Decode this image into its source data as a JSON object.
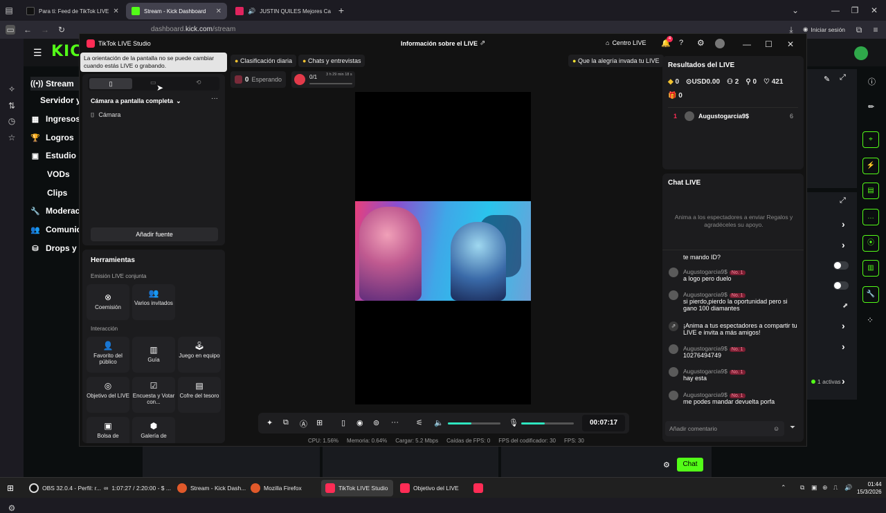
{
  "browser": {
    "tabs": [
      {
        "title": "Para ti: Feed de TikTok LIVE",
        "active": false
      },
      {
        "title": "Stream - Kick Dashboard",
        "active": true
      },
      {
        "title": "JUSTIN QUILES Mejores Ca",
        "active": false
      }
    ],
    "url_prefix": "dashboard.",
    "url_domain": "kick.com",
    "url_path": "/stream",
    "signin_label": "Iniciar sesión"
  },
  "kick": {
    "logo": "KICK",
    "menu": [
      {
        "label": "Stream",
        "icon": "stream-icon"
      },
      {
        "label": "Servidor y",
        "icon": ""
      },
      {
        "label": "Ingresos",
        "icon": "wallet-icon"
      },
      {
        "label": "Logros",
        "icon": "trophy-icon"
      },
      {
        "label": "Estudio",
        "icon": "studio-icon"
      },
      {
        "label": "VODs",
        "icon": ""
      },
      {
        "label": "Clips",
        "icon": ""
      },
      {
        "label": "Moderac",
        "icon": "moderation-icon"
      },
      {
        "label": "Comunid",
        "icon": "community-icon"
      },
      {
        "label": "Drops y r",
        "icon": "drops-icon"
      }
    ],
    "active_count": "1 activas",
    "chat_button": "Chat"
  },
  "tiktok": {
    "app_title": "TikTok LIVE Studio",
    "center_title": "Información sobre el LIVE",
    "centro_live": "Centro LIVE",
    "notif_count": "4",
    "tooltip": "La orientación de la pantalla no se puede cambiar cuando estás LIVE o grabando.",
    "scene_name": "Cámara a pantalla completa",
    "source_name": "Cámara",
    "add_source": "Añadir fuente",
    "tools_title": "Herramientas",
    "section_coop": "Emisión LIVE conjunta",
    "section_interaction": "Interacción",
    "tools_coop": [
      "Coemisión",
      "Varios invitados"
    ],
    "tools_interaction": [
      "Favorito del público",
      "Guía",
      "Juego en equipo",
      "Objetivo del LIVE",
      "Encuesta y Votar con...",
      "Cofre del tesoro",
      "Bolsa de",
      "Galería de"
    ],
    "chips": [
      "Clasificación diaria",
      "Chats y entrevistas"
    ],
    "joy_chip": "Que la alegría invada tu LIVE",
    "waiting": {
      "count": "0",
      "label": "Esperando"
    },
    "goal": {
      "progress": "0/1",
      "time": "3 h 29 min 18 s",
      "fraction": 0.0
    },
    "timer": "00:07:17",
    "volume_level": 0.45,
    "mic_level": 0.45,
    "stats": {
      "cpu": "CPU:  1.56%",
      "memory": "Memoria:  0.64%",
      "load": "Cargar:  5.2 Mbps",
      "dropped": "Caídas de FPS:  0",
      "encoder": "FPS del codificador:  30",
      "fps": "FPS:  30"
    },
    "results": {
      "title": "Resultados del LIVE",
      "diamonds": "0",
      "usd": "USD0.00",
      "viewers": "2",
      "new_followers": "0",
      "likes": "421",
      "gifts": "0",
      "rank": "1",
      "top_user": "Augustogarcia9$",
      "top_score": "6"
    },
    "chat": {
      "title": "Chat LIVE",
      "empty_hint": "Anima a los espectadores a enviar Regalos y agradéceles su apoyo.",
      "partial_top": "te mando ID?",
      "messages": [
        {
          "user": "Augustogarcia9$",
          "badge": "No. 1",
          "text": "a logo pero duelo"
        },
        {
          "user": "Augustogarcia9$",
          "badge": "No. 1",
          "text": "si pierdo,pierdo la oportunidad pero si gano 100 diamantes"
        },
        {
          "user": "",
          "badge": "",
          "text": "¡Anima a tus espectadores a compartir tu LIVE e invita a más amigos!"
        },
        {
          "user": "Augustogarcia9$",
          "badge": "No. 1",
          "text": "10276494749"
        },
        {
          "user": "Augustogarcia9$",
          "badge": "No. 1",
          "text": "hay esta"
        },
        {
          "user": "Augustogarcia9$",
          "badge": "No. 1",
          "text": "me podes mandar devuelta porfa"
        }
      ],
      "input_placeholder": "Añadir comentario"
    }
  },
  "taskbar": {
    "items": [
      {
        "label": "OBS 32.0.4 - Perfil: r...",
        "active": false
      },
      {
        "label": "1:07:27 / 2:20:00 - $ ...",
        "active": false
      },
      {
        "label": "Stream - Kick Dash...",
        "active": false
      },
      {
        "label": "Mozilla Firefox",
        "active": false
      },
      {
        "label": "TikTok LIVE Studio",
        "active": true
      },
      {
        "label": "Objetivo del LIVE",
        "active": false
      }
    ],
    "time": "01:44",
    "date": "15/3/2026"
  },
  "colors": {
    "kick_green": "#53fc18",
    "tiktok_red": "#fe2c55",
    "slider": "#2ee6c0"
  }
}
